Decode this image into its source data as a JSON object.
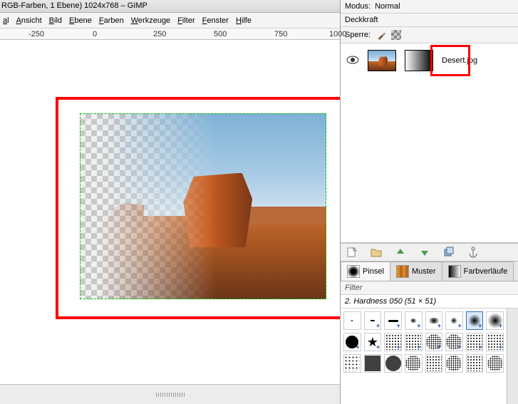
{
  "window": {
    "title": "RGB-Farben, 1 Ebene) 1024x768 – GIMP"
  },
  "menu": {
    "items": [
      "al",
      "Ansicht",
      "Bild",
      "Ebene",
      "Farben",
      "Werkzeuge",
      "Filter",
      "Fenster",
      "Hilfe"
    ]
  },
  "ruler": {
    "ticks": [
      "-250",
      "0",
      "250",
      "500",
      "750",
      "1000"
    ]
  },
  "right_panel": {
    "mode_label": "Modus:",
    "mode_value": "Normal",
    "opacity_label": "Deckkraft",
    "lock_label": "Sperre:"
  },
  "layer": {
    "name": "Desert.jpg"
  },
  "tabs": {
    "pinsel": "Pinsel",
    "muster": "Muster",
    "farbverlaeufe": "Farbverläufe"
  },
  "filter_label": "Filter",
  "brush_label": "2. Hardness 050 (51 × 51)"
}
